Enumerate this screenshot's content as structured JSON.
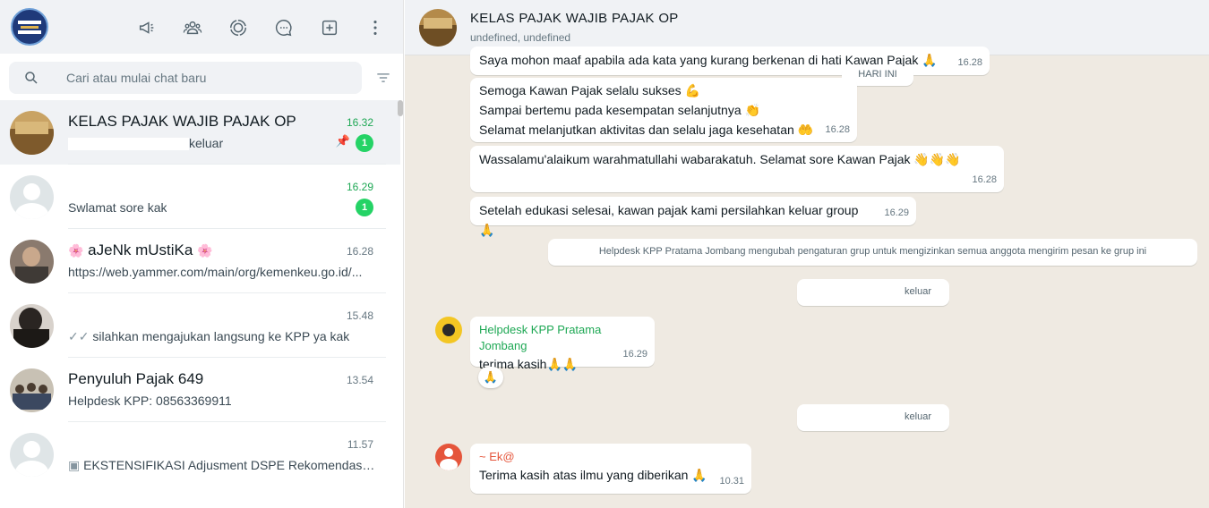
{
  "sidebar": {
    "search_placeholder": "Cari atau mulai chat baru",
    "header_icons": [
      "megaphone-icon",
      "communities-icon",
      "status-icon",
      "channels-icon",
      "new-chat-icon",
      "menu-icon"
    ],
    "chats": [
      {
        "name": "KELAS PAJAK WAJIB PAJAK OP",
        "time": "16.32",
        "preview": "keluar",
        "unread": "1",
        "pinned": true
      },
      {
        "name": "",
        "time": "16.29",
        "preview": "Swlamat sore kak",
        "unread": "1"
      },
      {
        "name": "aJeNk mUstiKa",
        "time": "16.28",
        "preview": "https://web.yammer.com/main/org/kemenkeu.go.id/..."
      },
      {
        "name": "",
        "time": "15.48",
        "preview": "silahkan mengajukan langsung ke KPP ya kak"
      },
      {
        "name": "Penyuluh Pajak 649",
        "time": "13.54",
        "preview": "Helpdesk KPP: 08563369911"
      },
      {
        "name": "",
        "time": "11.57",
        "preview": "EKSTENSIFIKASI Adjusment DSPE Rekomendasi - ..."
      }
    ]
  },
  "conversation": {
    "title": "KELAS PAJAK WAJIB PAJAK OP",
    "subtitle": "undefined, undefined",
    "date_label": "HARI INI",
    "messages": [
      {
        "text": "Saya mohon maaf apabila ada kata yang kurang berkenan di hati Kawan Pajak",
        "time": "16.28"
      },
      {
        "line1": "Semoga Kawan Pajak selalu sukses",
        "line2": "Sampai bertemu pada kesempatan selanjutnya",
        "line3": "Selamat melanjutkan aktivitas dan selalu jaga kesehatan",
        "time": "16.28"
      },
      {
        "text": "Wassalamu'alaikum warahmatullahi wabarakatuh. Selamat sore Kawan Pajak",
        "time": "16.28"
      },
      {
        "text": "Setelah edukasi selesai, kawan pajak kami persilahkan keluar group",
        "time": "16.29"
      },
      {
        "system": "Helpdesk KPP Pratama Jombang mengubah pengaturan grup untuk mengizinkan semua anggota mengirim pesan ke grup ini"
      },
      {
        "system": "keluar"
      },
      {
        "sender": "Helpdesk KPP Pratama Jombang",
        "text": "terima kasih",
        "time": "16.29"
      },
      {
        "system": "keluar"
      },
      {
        "sender": "~ Ek@",
        "text": "Terima kasih atas ilmu yang diberikan",
        "time": "10.31"
      }
    ]
  },
  "colors": {
    "unread_green": "#25d366",
    "time_green": "#1fa855",
    "chat_bg": "#efeae2",
    "sender_green": "#1fa855",
    "sender_orange": "#e5553b"
  }
}
